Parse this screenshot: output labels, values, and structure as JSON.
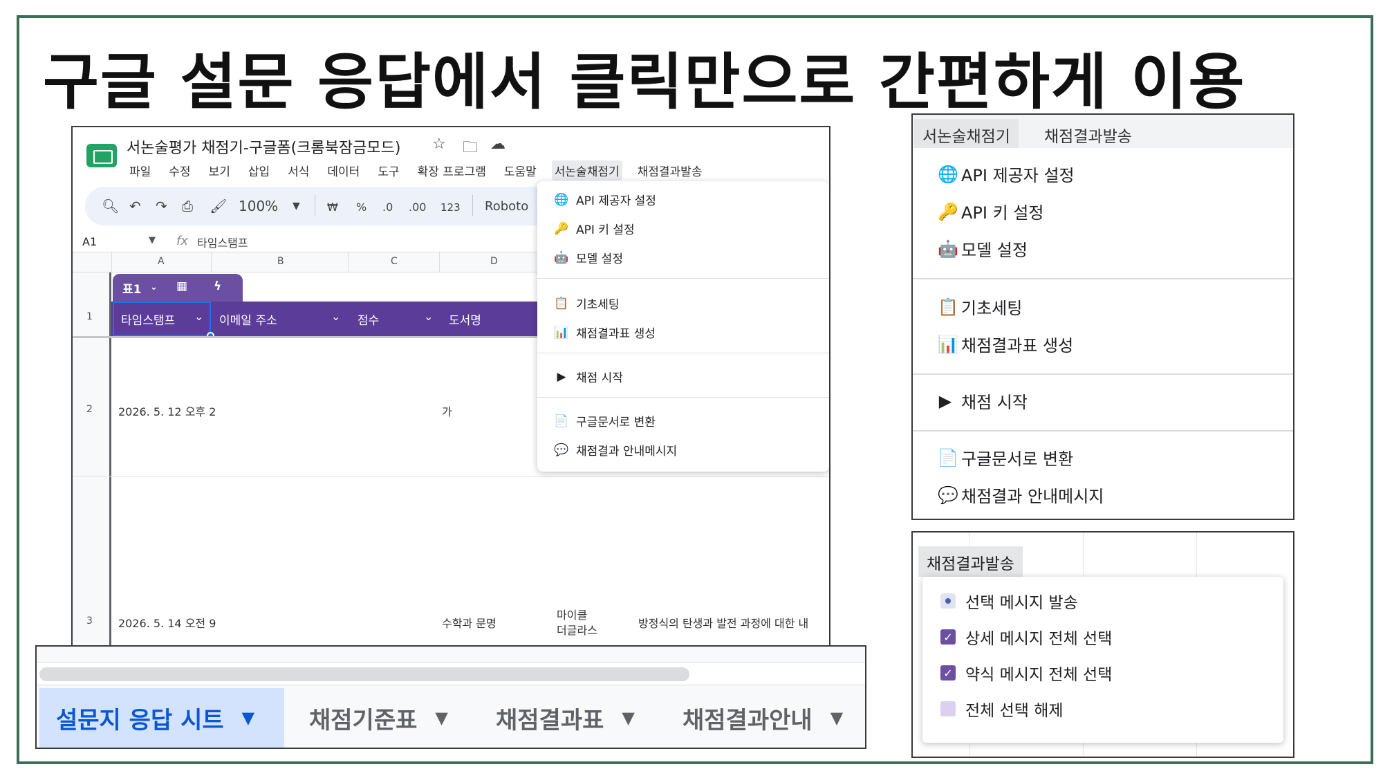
{
  "slide": {
    "title": "구글 설문 응답에서 클릭만으로 간편하게 이용"
  },
  "sheet": {
    "doc_title": "서논술평가 채점기-구글폼(크롬북잠금모드)",
    "menus": [
      "파일",
      "수정",
      "보기",
      "삽입",
      "서식",
      "데이터",
      "도구",
      "확장 프로그램",
      "도움말",
      "서논술채점기",
      "채점결과발송"
    ],
    "toolbar": {
      "zoom": "100%",
      "currency": "₩",
      "percent": "%",
      "dec_minus": ".0",
      "dec_plus": ".00",
      "number_fmt": "123",
      "font": "Roboto"
    },
    "cell_ref": "A1",
    "fx": "fx",
    "formula_value": "타임스탬프",
    "columns": [
      "A",
      "B",
      "C",
      "D"
    ],
    "table_chip": "표1",
    "headers": [
      "타임스탬프",
      "이메일 주소",
      "점수",
      "도서명"
    ],
    "rows": [
      {
        "num": "1"
      },
      {
        "num": "2",
        "timestamp": "2026. 5. 12 오후 2",
        "d": "가"
      },
      {
        "num": "3",
        "timestamp": "2026. 5. 14 오전 9",
        "d": "수학과 문명",
        "e1": "마이클",
        "e2": "더글라스",
        "f": "방정식의 탄생과 발전 과정에 대한 내"
      }
    ],
    "dropdown": {
      "group1": [
        {
          "icon": "globe-icon",
          "glyph": "🌐",
          "label": "API 제공자 설정"
        },
        {
          "icon": "key-icon",
          "glyph": "🔑",
          "label": "API 키 설정"
        },
        {
          "icon": "robot-icon",
          "glyph": "🤖",
          "label": "모델 설정"
        }
      ],
      "group2": [
        {
          "icon": "clipboard-icon",
          "glyph": "📋",
          "label": "기초세팅"
        },
        {
          "icon": "bar-chart-icon",
          "glyph": "📊",
          "label": "채점결과표 생성"
        }
      ],
      "group3": [
        {
          "icon": "play-icon",
          "glyph": "▶",
          "label": "채점 시작"
        }
      ],
      "group4": [
        {
          "icon": "document-icon",
          "glyph": "📄",
          "label": "구글문서로 변환"
        },
        {
          "icon": "speech-bubble-icon",
          "glyph": "💬",
          "label": "채점결과 안내메시지"
        }
      ]
    }
  },
  "tabs": [
    {
      "label": "설문지 응답 시트",
      "active": true
    },
    {
      "label": "채점기준표"
    },
    {
      "label": "채점결과표"
    },
    {
      "label": "채점결과안내"
    }
  ],
  "menu_panel": {
    "tabs": [
      "서논술채점기",
      "채점결과발송"
    ],
    "items": {
      "api_provider": "API 제공자 설정",
      "api_key": "API 키 설정",
      "model": "모델 설정",
      "setup": "기초세팅",
      "result_table": "채점결과표 생성",
      "start": "채점 시작",
      "to_docs": "구글문서로 변환",
      "message": "채점결과 안내메시지"
    }
  },
  "send_panel": {
    "tab": "채점결과발송",
    "items": {
      "send_selected": "선택 메시지 발송",
      "select_detailed": "상세 메시지 전체 선택",
      "select_brief": "약식 메시지 전체 선택",
      "deselect_all": "전체 선택 해제"
    }
  },
  "colors": {
    "frame": "#3c6e55",
    "table_header": "#5b3d99",
    "active_tab": "#d3e3fd",
    "checkbox": "#6b4fa3"
  }
}
